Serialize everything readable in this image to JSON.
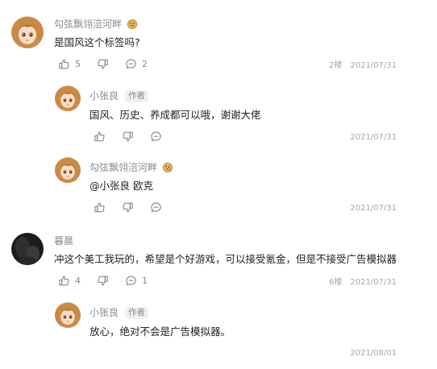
{
  "comments": [
    {
      "username": "勾弦飘翎涪河畔",
      "text": "是国风这个标签吗?",
      "likes": "5",
      "replies_count": "2",
      "floor": "2楼",
      "date": "2021/07/31",
      "replies": [
        {
          "username": "小张良",
          "badge": "作者",
          "text": "国风、历史、养成都可以哦，谢谢大佬",
          "date": "2021/07/31"
        },
        {
          "username": "勾弦飘翎涪河畔",
          "mention": "@小张良",
          "text": "欧克",
          "date": "2021/07/31"
        }
      ]
    },
    {
      "username": "暮晨",
      "text": "冲这个美工我玩的，希望是个好游戏，可以接受氪金，但是不接受广告模拟器",
      "likes": "4",
      "replies_count": "1",
      "floor": "6楼",
      "date": "2021/07/31",
      "replies": [
        {
          "username": "小张良",
          "badge": "作者",
          "text": "放心，绝对不会是广告模拟器。",
          "date": "2021/08/01"
        }
      ]
    }
  ],
  "colors": {
    "text": "#222222",
    "muted": "#8a8a8a",
    "meta": "#a6a6a6",
    "icon": "#888888"
  }
}
